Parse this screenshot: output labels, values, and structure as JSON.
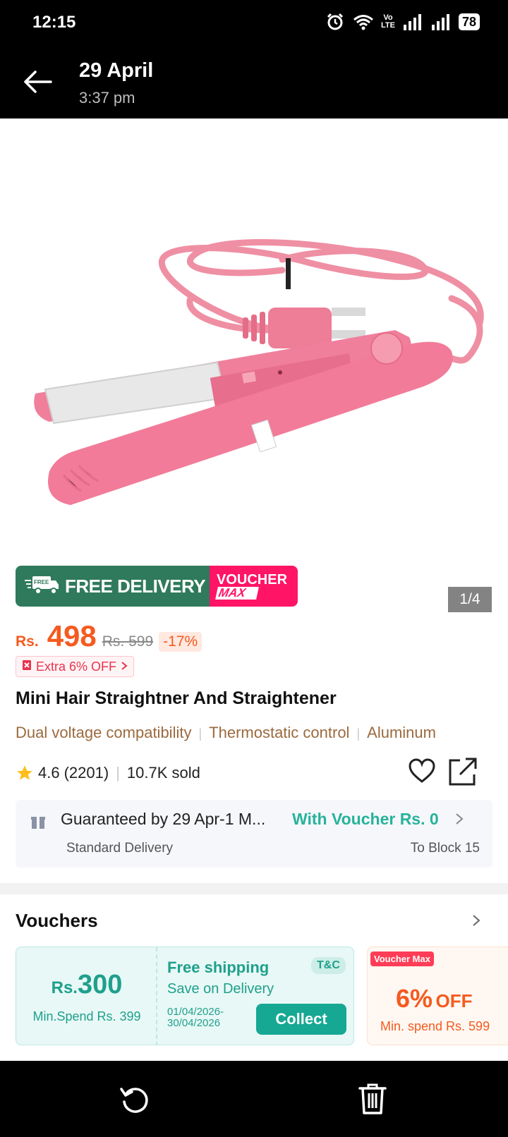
{
  "status_bar": {
    "time": "12:15",
    "network_label_1": "Vo",
    "network_label_2": "LTE",
    "battery": "78"
  },
  "header": {
    "title": "29 April",
    "subtitle": "3:37 pm"
  },
  "gallery": {
    "counter": "1/4",
    "image_subject": "pink mini hair straightener with coiled cord and plug"
  },
  "banner": {
    "free_badge": "FREE",
    "free_delivery": "FREE DELIVERY",
    "voucher_line1": "VOUCHER",
    "voucher_line2": "MAX"
  },
  "price": {
    "currency": "Rs.",
    "value": "498",
    "original": "Rs. 599",
    "discount": "-17%"
  },
  "extra_offer": "Extra 6% OFF",
  "product_name": "Mini Hair Straightner And Straightener",
  "features": [
    "Dual voltage compatibility",
    "Thermostatic control",
    "Aluminum"
  ],
  "rating": {
    "score": "4.6",
    "count": "(2201)",
    "sold": "10.7K sold"
  },
  "delivery": {
    "guarantee": "Guaranteed by 29 Apr-1 M...",
    "voucher": "With Voucher Rs. 0",
    "method": "Standard Delivery",
    "destination": "To Block 15"
  },
  "vouchers": {
    "title": "Vouchers",
    "card1": {
      "currency": "Rs.",
      "amount": "300",
      "min_spend": "Min.Spend Rs. 399",
      "title": "Free shipping",
      "tc": "T&C",
      "subtitle": "Save on Delivery",
      "dates": "01/04/2026-30/04/2026",
      "button": "Collect"
    },
    "card2": {
      "tag": "Voucher Max",
      "percent": "6%",
      "off": "OFF",
      "min_spend": "Min. spend Rs. 599"
    }
  },
  "colors": {
    "accent_orange": "#f55a1f",
    "teal": "#17a894",
    "free_delivery_green": "#2f7a5c",
    "voucher_pink": "#ff1466"
  }
}
